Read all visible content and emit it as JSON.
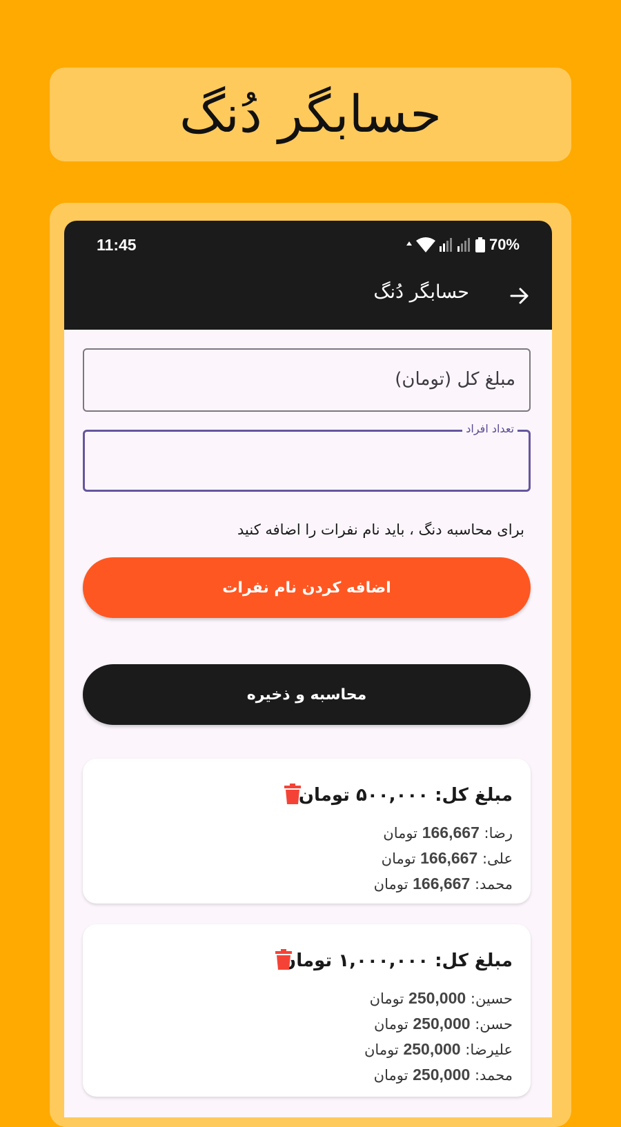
{
  "banner": {
    "title": "حسابگر دُنگ"
  },
  "status_bar": {
    "time": "11:45",
    "battery": "70%"
  },
  "app_bar": {
    "title": "حسابگر دُنگ"
  },
  "form": {
    "total_amount_placeholder": "مبلغ کل (تومان)",
    "people_count_label": "تعداد افراد",
    "people_count_value": ""
  },
  "hint": "برای محاسبه دنگ ، باید نام نفرات را اضافه کنید",
  "buttons": {
    "add_names": "اضافه کردن نام نفرات",
    "calculate_save": "محاسبه و ذخیره"
  },
  "colors": {
    "background": "#FFAA00",
    "banner": "#FFCA5C",
    "add_button": "#FF5722",
    "calc_button": "#1B1B1B",
    "trash": "#F44336",
    "focus": "#66559E"
  },
  "results": [
    {
      "total_label": "مبلغ کل:",
      "total": "۵۰۰,۰۰۰ تومان",
      "shares": [
        {
          "name": "رضا:",
          "amount": "166,667",
          "unit": "تومان"
        },
        {
          "name": "علی:",
          "amount": "166,667",
          "unit": "تومان"
        },
        {
          "name": "محمد:",
          "amount": "166,667",
          "unit": "تومان"
        }
      ]
    },
    {
      "total_label": "مبلغ کل:",
      "total": "۱,۰۰۰,۰۰۰ تومان",
      "shares": [
        {
          "name": "حسین:",
          "amount": "250,000",
          "unit": "تومان"
        },
        {
          "name": "حسن:",
          "amount": "250,000",
          "unit": "تومان"
        },
        {
          "name": "علیرضا:",
          "amount": "250,000",
          "unit": "تومان"
        },
        {
          "name": "محمد:",
          "amount": "250,000",
          "unit": "تومان"
        }
      ]
    }
  ]
}
